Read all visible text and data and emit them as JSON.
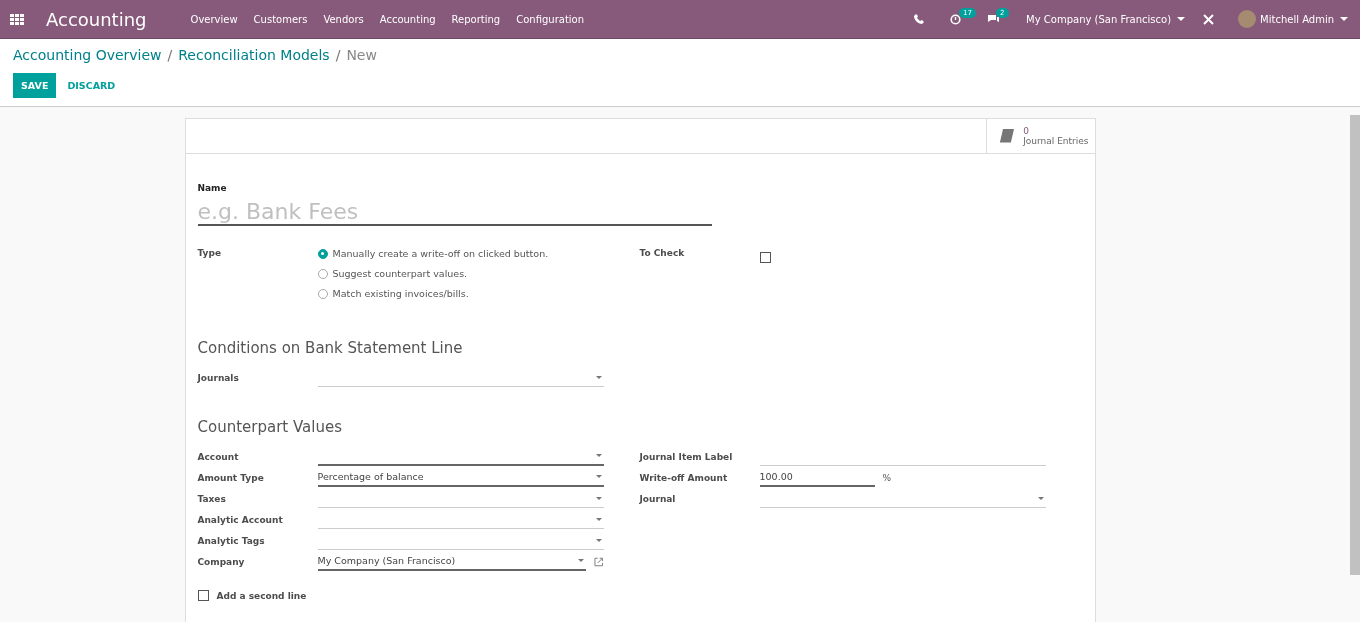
{
  "navbar": {
    "app_title": "Accounting",
    "menu": [
      "Overview",
      "Customers",
      "Vendors",
      "Accounting",
      "Reporting",
      "Configuration"
    ],
    "activity_count": "17",
    "message_count": "2",
    "company": "My Company (San Francisco)",
    "user": "Mitchell Admin"
  },
  "breadcrumb": [
    {
      "label": "Accounting Overview",
      "link": true
    },
    {
      "label": "Reconciliation Models",
      "link": true
    },
    {
      "label": "New",
      "link": false
    }
  ],
  "breadcrumb_separator": "/",
  "buttons": {
    "save": "SAVE",
    "discard": "DISCARD"
  },
  "smart_button": {
    "count": "0",
    "label": "Journal Entries"
  },
  "name_field": {
    "label": "Name",
    "placeholder": "e.g. Bank Fees"
  },
  "type": {
    "label": "Type",
    "options": [
      {
        "label": "Manually create a write-off on clicked button.",
        "selected": true
      },
      {
        "label": "Suggest counterpart values.",
        "selected": false
      },
      {
        "label": "Match existing invoices/bills.",
        "selected": false
      }
    ]
  },
  "to_check": {
    "label": "To Check",
    "checked": false
  },
  "conditions": {
    "title": "Conditions on Bank Statement Line",
    "fields": [
      {
        "label": "Journals",
        "required": false,
        "kind": "select"
      }
    ]
  },
  "counterpart": {
    "title": "Counterpart Values",
    "left": [
      {
        "label": "Account",
        "required": true,
        "kind": "select"
      },
      {
        "label": "Amount Type",
        "value": "Percentage of balance",
        "required": true,
        "kind": "select"
      },
      {
        "label": "Taxes",
        "required": false,
        "kind": "select"
      },
      {
        "label": "Analytic Account",
        "required": false,
        "kind": "select"
      },
      {
        "label": "Analytic Tags",
        "required": false,
        "kind": "select"
      },
      {
        "label": "Company",
        "value": "My Company (San Francisco)",
        "required": true,
        "kind": "link-select"
      }
    ],
    "right": [
      {
        "label": "Journal Item Label",
        "required": false,
        "kind": "text"
      },
      {
        "label": "Write-off Amount",
        "value": "100.00",
        "required": true,
        "kind": "percent",
        "suffix": "%"
      },
      {
        "label": "Journal",
        "required": false,
        "kind": "select"
      }
    ]
  },
  "second_line": {
    "label": "Add a second line",
    "checked": false
  }
}
